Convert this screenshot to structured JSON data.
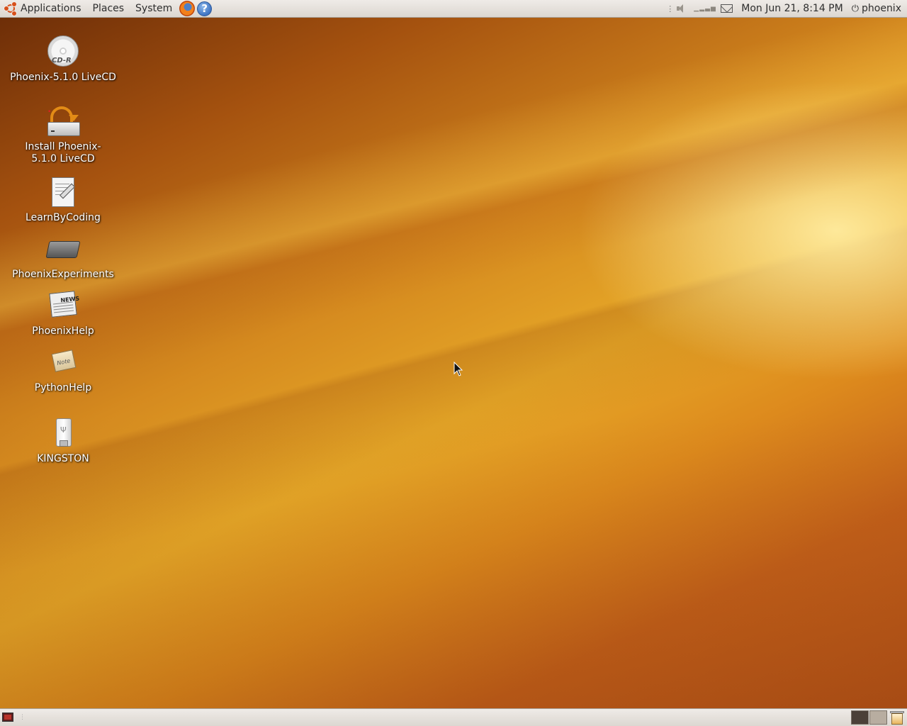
{
  "top_panel": {
    "menus": {
      "applications": "Applications",
      "places": "Places",
      "system": "System"
    },
    "launchers": [
      "firefox-icon",
      "help-icon"
    ],
    "help_glyph": "?",
    "clock": "Mon Jun 21,  8:14 PM",
    "user": "phoenix"
  },
  "desktop": {
    "icons": [
      {
        "label": "Phoenix-5.1.0 LiveCD",
        "icon": "cd-icon",
        "disc_text": "CD-R"
      },
      {
        "label": "Install Phoenix-5.1.0 LiveCD",
        "icon": "installer-icon"
      },
      {
        "label": "LearnByCoding",
        "icon": "text-document-icon"
      },
      {
        "label": "PhoenixExperiments",
        "icon": "chip-icon"
      },
      {
        "label": "PhoenixHelp",
        "icon": "newspaper-icon",
        "paper_text": "NEWS"
      },
      {
        "label": "PythonHelp",
        "icon": "note-icon",
        "note_text": "Note"
      },
      {
        "label": "KINGSTON",
        "icon": "usb-drive-icon"
      }
    ]
  },
  "bottom_panel": {
    "workspaces": [
      "workspace-1",
      "workspace-2"
    ],
    "trash": "trash-icon"
  },
  "colors": {
    "panel": "#dcd7d1",
    "wallpaper_dark": "#6e2e08",
    "wallpaper_light": "#e7a928",
    "ubuntu_orange": "#d7501b"
  }
}
